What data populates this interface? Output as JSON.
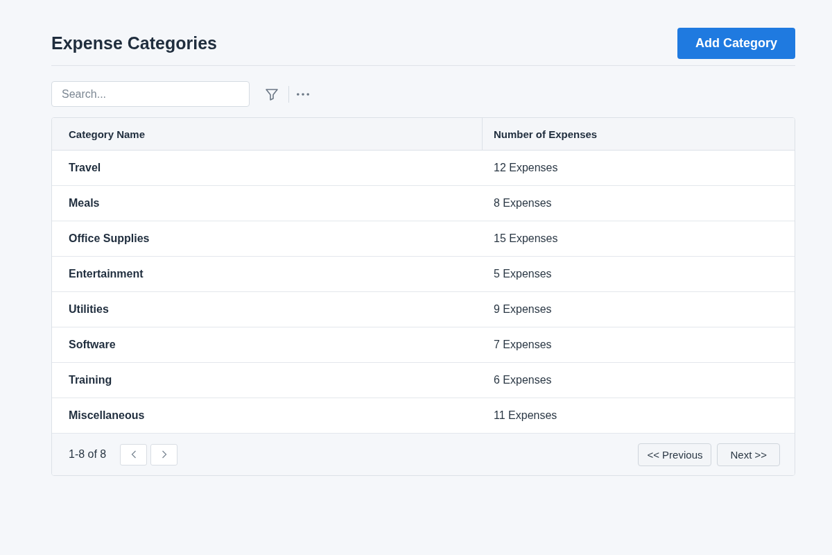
{
  "header": {
    "title": "Expense Categories",
    "add_button": "Add Category"
  },
  "toolbar": {
    "search": {
      "placeholder": "Search..."
    }
  },
  "table": {
    "columns": [
      "Category Name",
      "Number of Expenses"
    ],
    "rows": [
      {
        "name": "Travel",
        "count": "12 Expenses"
      },
      {
        "name": "Meals",
        "count": "8 Expenses"
      },
      {
        "name": "Office Supplies",
        "count": "15 Expenses"
      },
      {
        "name": "Entertainment",
        "count": "5 Expenses"
      },
      {
        "name": "Utilities",
        "count": "9 Expenses"
      },
      {
        "name": "Software",
        "count": "7 Expenses"
      },
      {
        "name": "Training",
        "count": "6 Expenses"
      },
      {
        "name": "Miscellaneous",
        "count": "11 Expenses"
      }
    ]
  },
  "pagination": {
    "range": "1-8 of 8",
    "previous": "<< Previous",
    "next": "Next >>"
  }
}
